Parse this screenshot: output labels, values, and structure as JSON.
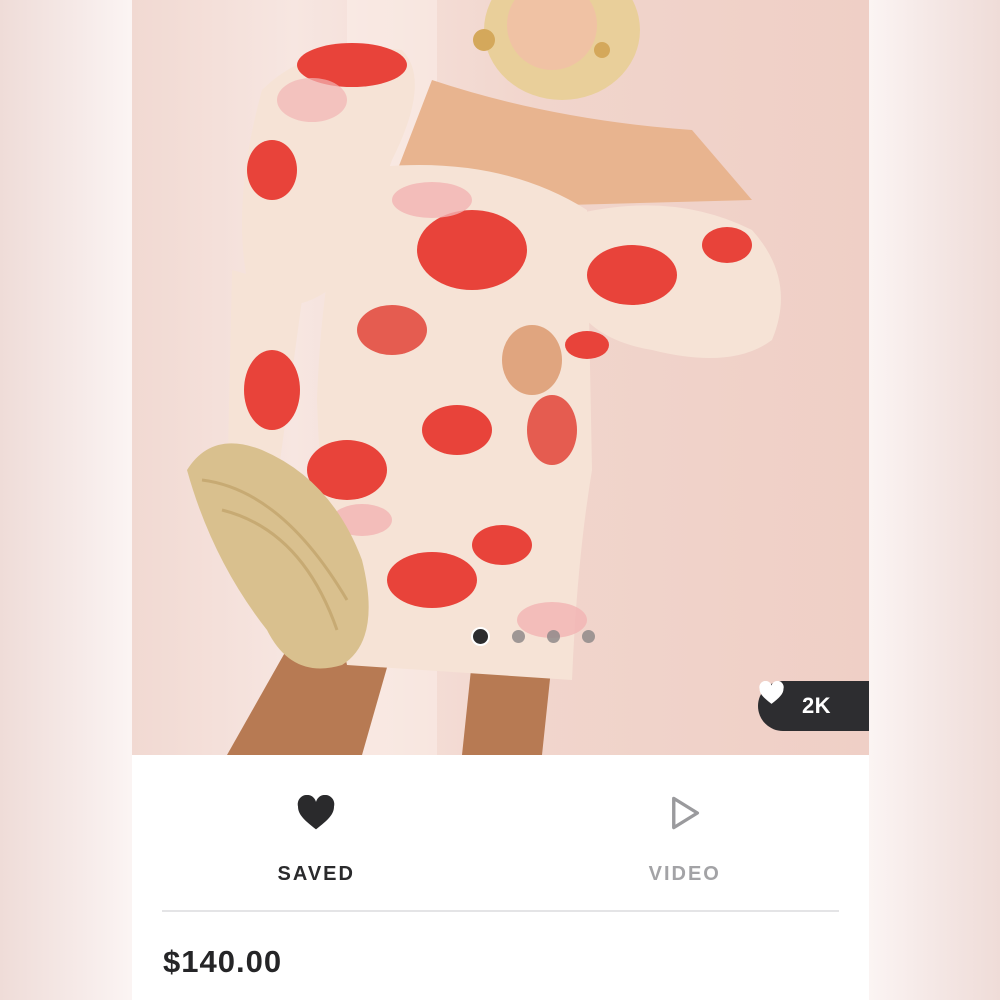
{
  "product": {
    "image_description": "",
    "carousel": {
      "count": 4,
      "active_index": 0
    },
    "likes_label": "2K",
    "price": "$140.00"
  },
  "actions": {
    "saved_label": "SAVED",
    "video_label": "VIDEO"
  },
  "icons": {
    "saved": "heart-filled-icon",
    "video": "play-outline-icon",
    "likes": "heart-filled-icon"
  },
  "colors": {
    "dark": "#2d2d30",
    "muted": "#a3a3a6",
    "divider": "#e4e4e6",
    "dress_red": "#e8433a",
    "dress_cream": "#f6e3d6"
  }
}
